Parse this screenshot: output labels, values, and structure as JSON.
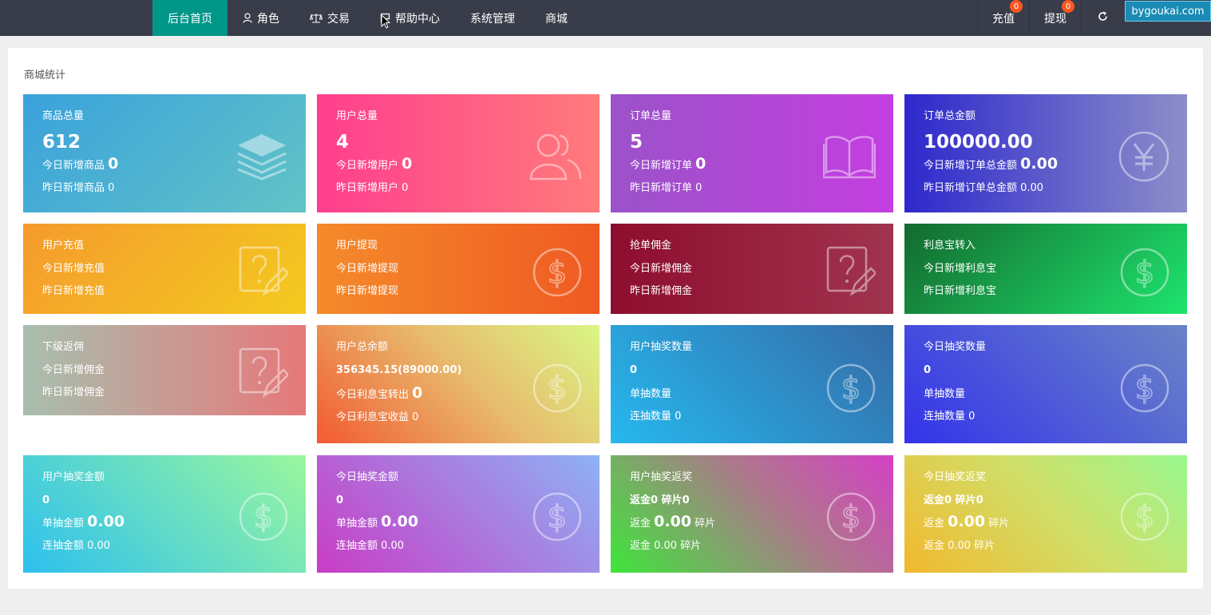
{
  "nav": {
    "items": [
      {
        "label": "后台首页",
        "icon": "home",
        "active": true
      },
      {
        "label": "角色",
        "icon": "user-icon",
        "active": false
      },
      {
        "label": "交易",
        "icon": "scale-icon",
        "active": false
      },
      {
        "label": "帮助中心",
        "icon": "flag-icon",
        "active": false
      },
      {
        "label": "系统管理",
        "icon": "",
        "active": false
      },
      {
        "label": "商城",
        "icon": "",
        "active": false
      }
    ],
    "recharge": {
      "label": "充值",
      "badge": "0"
    },
    "withdraw": {
      "label": "提现",
      "badge": "0"
    },
    "refresh_icon": "refresh-icon"
  },
  "watermark": "bygoukai.com",
  "panel": {
    "title": "商城统计"
  },
  "cards": [
    {
      "title": "商品总量",
      "value": "612",
      "line1": "今日新增商品",
      "line1_value": "0",
      "line2": "昨日新增商品 0",
      "icon": "layers-icon"
    },
    {
      "title": "用户总量",
      "value": "4",
      "line1": "今日新增用户",
      "line1_value": "0",
      "line2": "昨日新增用户 0",
      "icon": "users-icon"
    },
    {
      "title": "订单总量",
      "value": "5",
      "line1": "今日新增订单",
      "line1_value": "0",
      "line2": "昨日新增订单 0",
      "icon": "book-icon"
    },
    {
      "title": "订单总金额",
      "value": "100000.00",
      "line1": "今日新增订单总金额",
      "line1_value": "0.00",
      "line2": "昨日新增订单总金额 0.00",
      "icon": "yen-icon"
    },
    {
      "title": "用户充值",
      "line1": "今日新增充值",
      "line2": "昨日新增充值",
      "icon": "question-edit-icon"
    },
    {
      "title": "用户提现",
      "line1": "今日新增提现",
      "line2": "昨日新增提现",
      "icon": "dollar-icon"
    },
    {
      "title": "抢单佣金",
      "line1": "今日新增佣金",
      "line2": "昨日新增佣金",
      "icon": "question-edit-icon"
    },
    {
      "title": "利息宝转入",
      "line1": "今日新增利息宝",
      "line2": "昨日新增利息宝",
      "icon": "dollar-icon"
    },
    {
      "title": "下级返佣",
      "line1": "今日新增佣金",
      "line2": "昨日新增佣金",
      "icon": "question-edit-icon"
    },
    {
      "title": "用户总余额",
      "value": "356345.15(89000.00)",
      "line1": "今日利息宝转出",
      "line1_value": "0",
      "line2": "今日利息宝收益 0",
      "icon": "dollar-icon"
    },
    {
      "title": "用户抽奖数量",
      "value": "0",
      "line1": "单抽数量",
      "line2": "连抽数量 0",
      "icon": "dollar-icon"
    },
    {
      "title": "今日抽奖数量",
      "value": "0",
      "line1": "单抽数量",
      "line2": "连抽数量 0",
      "icon": "dollar-icon"
    },
    {
      "title": "用户抽奖金额",
      "value": "0",
      "line1": "单抽金额",
      "line1_value": "0.00",
      "line2": "连抽金额 0.00",
      "icon": "dollar-icon"
    },
    {
      "title": "今日抽奖金额",
      "value": "0",
      "line1": "单抽金额",
      "line1_value": "0.00",
      "line2": "连抽金额 0.00",
      "icon": "dollar-icon"
    },
    {
      "title": "用户抽奖返奖",
      "value": "返金0 碎片0",
      "line1": "返金",
      "line1_value": "0.00",
      "line1_suffix": "碎片",
      "line2": "返金 0.00 碎片",
      "icon": "dollar-icon"
    },
    {
      "title": "今日抽奖返奖",
      "value": "返金0 碎片0",
      "line1": "返金",
      "line1_value": "0.00",
      "line1_suffix": "碎片",
      "line2": "返金 0.00 碎片",
      "icon": "dollar-icon"
    }
  ]
}
